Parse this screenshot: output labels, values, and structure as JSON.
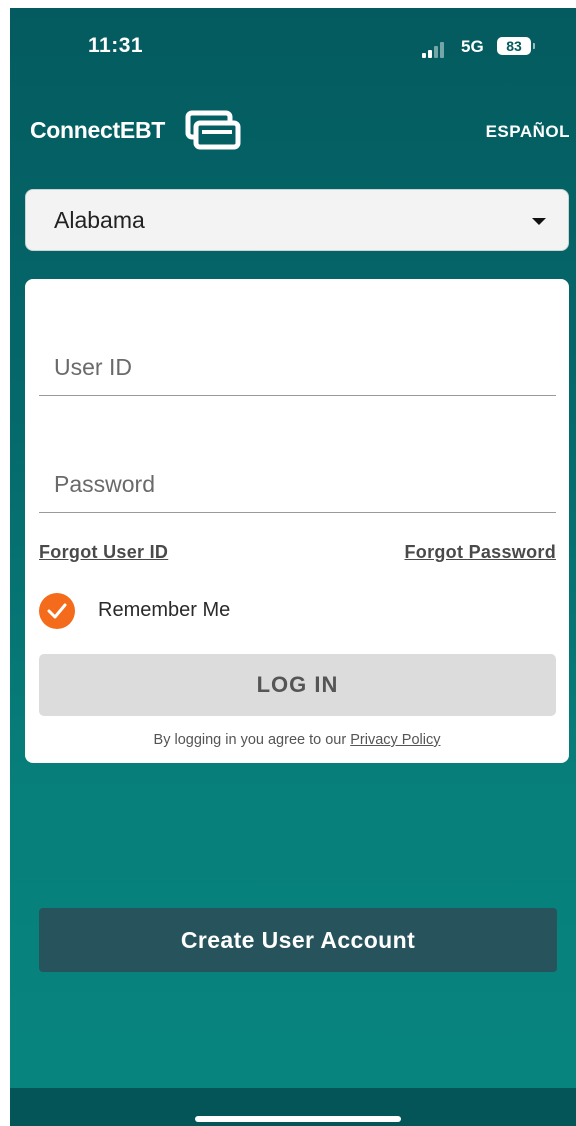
{
  "status_bar": {
    "time": "11:31",
    "network": "5G",
    "battery": "83"
  },
  "header": {
    "brand": "ConnectEBT",
    "language_link": "ESPAÑOL"
  },
  "state_select": {
    "selected": "Alabama"
  },
  "login_form": {
    "user_id_placeholder": "User ID",
    "password_placeholder": "Password",
    "forgot_user_id": "Forgot User ID",
    "forgot_password": "Forgot Password",
    "remember_me_label": "Remember Me",
    "remember_me_checked": true,
    "login_button": "LOG IN",
    "agree_text": "By logging in you agree to our",
    "privacy_policy_link": "Privacy Policy"
  },
  "create_account_button": "Create User Account",
  "colors": {
    "background_top": "#045b5f",
    "background_bottom": "#08857f",
    "checkbox": "#f36b1b",
    "create_button": "#26535c",
    "login_button": "#dcdcdc"
  },
  "icons": {
    "dropdown": "caret-down-icon",
    "logo": "card-stack-icon",
    "checkbox": "checkmark-icon",
    "signal": "signal-bars-icon",
    "battery": "battery-icon"
  }
}
